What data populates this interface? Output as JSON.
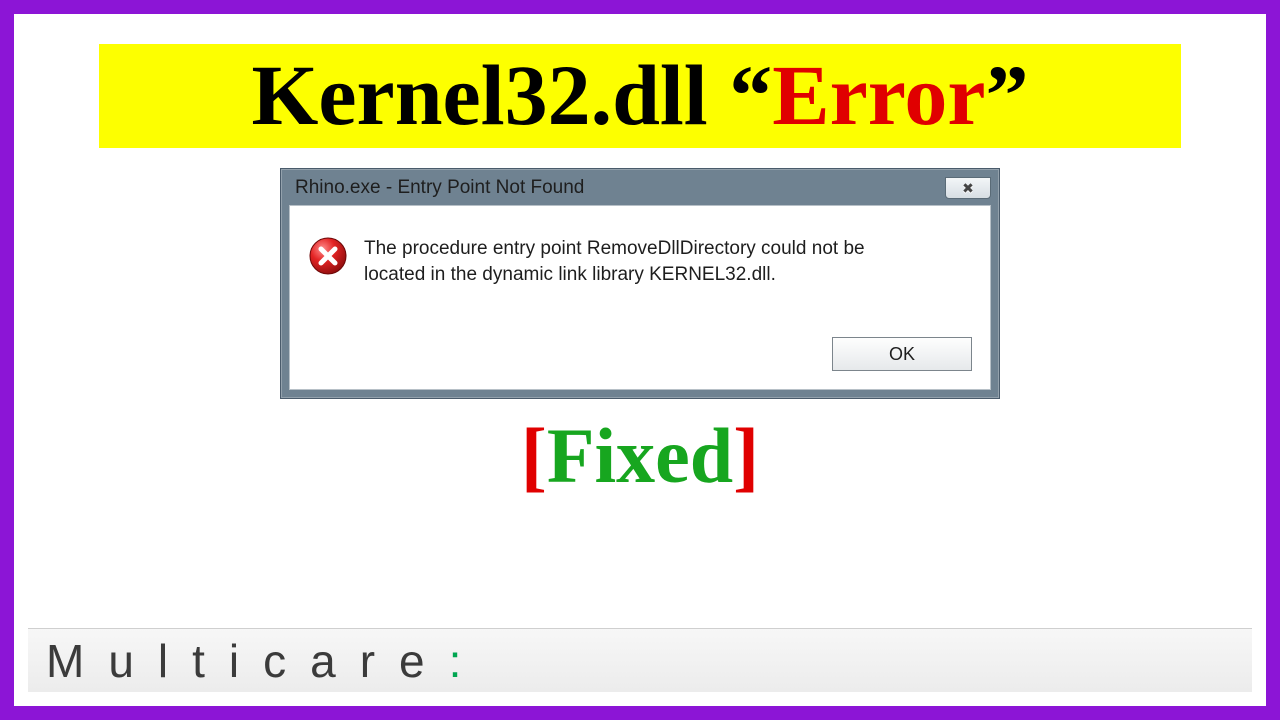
{
  "banner": {
    "part1": "Kernel32.dll ",
    "quote_open": "“",
    "error_word": "Error",
    "quote_close": "”"
  },
  "dialog": {
    "title": "Rhino.exe - Entry Point Not Found",
    "close_glyph": "✖",
    "message": "The procedure entry point RemoveDllDirectory could not be located in the dynamic link library KERNEL32.dll.",
    "ok_label": "OK"
  },
  "fixed": {
    "bracket_open": "[",
    "word": "Fixed",
    "bracket_close": "]"
  },
  "brand": {
    "name": "Multicare",
    "colon": ":"
  }
}
